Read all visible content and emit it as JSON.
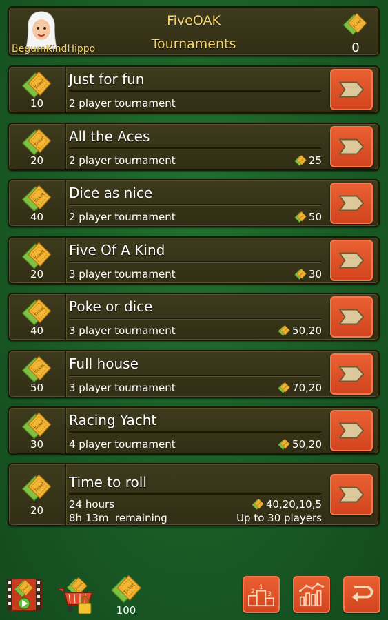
{
  "header": {
    "username": "BegumKindHippo",
    "app_title": "FiveOAK",
    "screen_title": "Tournaments",
    "ticket_count": "0"
  },
  "tournaments": [
    {
      "name": "Just for fun",
      "cost": "10",
      "players": "2 player tournament",
      "prize": ""
    },
    {
      "name": "All the Aces",
      "cost": "20",
      "players": "2 player tournament",
      "prize": "25"
    },
    {
      "name": "Dice as nice",
      "cost": "40",
      "players": "2 player tournament",
      "prize": "50"
    },
    {
      "name": "Five Of A Kind",
      "cost": "20",
      "players": "3 player tournament",
      "prize": "30"
    },
    {
      "name": "Poke or dice",
      "cost": "40",
      "players": "3 player tournament",
      "prize": "50,20"
    },
    {
      "name": "Full house",
      "cost": "50",
      "players": "3 player tournament",
      "prize": "70,20"
    },
    {
      "name": "Racing Yacht",
      "cost": "30",
      "players": "4 player tournament",
      "prize": "50,20"
    }
  ],
  "timed_tournament": {
    "name": "Time to roll",
    "cost": "20",
    "duration": "24 hours",
    "remaining": "8h 13m  remaining",
    "prize": "40,20,10,5",
    "max_players": "Up to 30 players"
  },
  "bottom_bar": {
    "ticket_count": "100"
  },
  "icons": {
    "ticket": "ticket-icon",
    "play": "play-arrow-icon",
    "video": "video-reward-icon",
    "shop": "shopping-cart-locked-icon",
    "leaderboard": "podium-icon",
    "stats": "stats-chart-icon",
    "back": "back-arrow-icon"
  },
  "colors": {
    "background": "#1b5e27",
    "panel": "#3a3619",
    "accent_button": "#e0532a",
    "title_text": "#f4d36b"
  }
}
